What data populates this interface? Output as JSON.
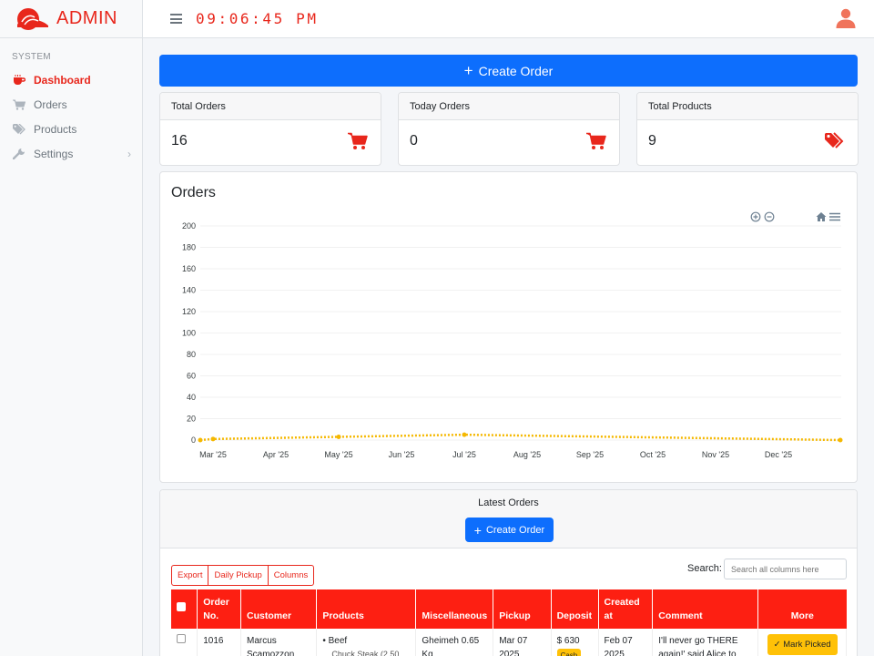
{
  "brand": {
    "name": "ADMIN",
    "accent": "#e8271c"
  },
  "topbar": {
    "clock": "09:06:45 PM"
  },
  "sidebar": {
    "section": "SYSTEM",
    "items": [
      {
        "label": "Dashboard",
        "icon": "coffee-cup-icon",
        "active": true
      },
      {
        "label": "Orders",
        "icon": "cart-icon"
      },
      {
        "label": "Products",
        "icon": "tags-icon"
      },
      {
        "label": "Settings",
        "icon": "wrench-icon",
        "has_children": true
      }
    ]
  },
  "main": {
    "create_order_label": "Create Order",
    "stats": [
      {
        "title": "Total Orders",
        "value": "16",
        "icon": "cart-icon"
      },
      {
        "title": "Today Orders",
        "value": "0",
        "icon": "cart-icon"
      },
      {
        "title": "Total Products",
        "value": "9",
        "icon": "tags-icon"
      }
    ]
  },
  "chart_data": {
    "type": "line",
    "title": "Orders",
    "x": [
      "Feb '25",
      "Mar '25",
      "May '25",
      "Jul '25",
      "Jan '26"
    ],
    "values": [
      0,
      1,
      3,
      5,
      0
    ],
    "xticks": [
      "Mar '25",
      "Apr '25",
      "May '25",
      "Jun '25",
      "Jul '25",
      "Aug '25",
      "Sep '25",
      "Oct '25",
      "Nov '25",
      "Dec '25"
    ],
    "yticks": [
      0,
      20,
      40,
      60,
      80,
      100,
      120,
      140,
      160,
      180,
      200
    ],
    "ylim": [
      0,
      200
    ],
    "grid": true,
    "color": "#f5b800",
    "toolbar": [
      "zoom-in-icon",
      "zoom-out-icon",
      "home-icon",
      "menu-icon"
    ]
  },
  "orders": {
    "title": "Latest Orders",
    "create_label": "Create Order",
    "buttons": [
      "Export",
      "Daily Pickup",
      "Columns"
    ],
    "search_label": "Search:",
    "search_placeholder": "Search all columns here",
    "columns": [
      "",
      "Order No.",
      "Customer",
      "Products",
      "Miscellaneous",
      "Pickup",
      "Deposit",
      "Created at",
      "Comment",
      "More"
    ],
    "rows": [
      {
        "order_no": "1016",
        "customer": "Marcus Scamozzon",
        "product": "Beef",
        "product_sub": "Chuck Steak (2.50",
        "misc": "Gheimeh 0.65 Kg",
        "pickup": "Mar 07 2025",
        "deposit": "$ 630",
        "deposit_badge": "Cash",
        "created": "Feb 07 2025",
        "comment": "I'll never go THERE again!' said Alice to",
        "action": "Mark Picked"
      }
    ]
  }
}
